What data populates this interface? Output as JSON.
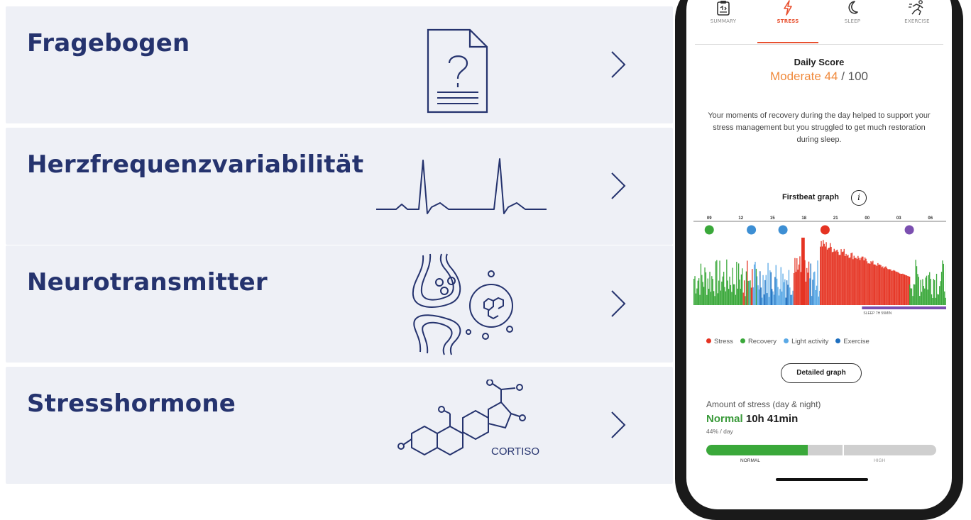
{
  "cards": [
    {
      "title": "Fragebogen",
      "icon": "questionnaire-document-icon"
    },
    {
      "title": "Herzfrequenzvariabilität",
      "icon": "heartbeat-ecg-icon"
    },
    {
      "title": "Neurotransmitter",
      "icon": "synapse-neurotransmitter-icon"
    },
    {
      "title": "Stresshormone",
      "icon": "cortisol-molecule-icon",
      "icon_label": "CORTISOL"
    }
  ],
  "colors": {
    "card_bg": "#eef0f6",
    "title": "#25336e",
    "stress": "#e53322",
    "recovery": "#3aa83a",
    "light_activity": "#5aa9e6",
    "exercise": "#1e6fbf",
    "accent": "#e8502f",
    "sleep": "#7b4fb0"
  },
  "app": {
    "tabs": [
      {
        "label": "SUMMARY",
        "icon": "summary-clipboard-icon",
        "active": false
      },
      {
        "label": "STRESS",
        "icon": "lightning-icon",
        "active": true
      },
      {
        "label": "SLEEP",
        "icon": "moon-icon",
        "active": false
      },
      {
        "label": "EXERCISE",
        "icon": "running-person-icon",
        "active": false
      }
    ],
    "daily_score": {
      "title": "Daily Score",
      "level": "Moderate",
      "value": "44",
      "max": "/ 100"
    },
    "description": "Your moments of recovery during the day helped to support your stress management but you struggled to get much restoration during sleep.",
    "graph": {
      "title": "Firstbeat graph",
      "info_icon": "info-icon",
      "sleep_label": "SLEEP 7H 59MIN"
    },
    "legend": [
      {
        "label": "Stress",
        "color": "#e53322"
      },
      {
        "label": "Recovery",
        "color": "#3aa83a"
      },
      {
        "label": "Light activity",
        "color": "#5aa9e6"
      },
      {
        "label": "Exercise",
        "color": "#1e6fbf"
      }
    ],
    "detailed_button": "Detailed graph",
    "amount": {
      "label": "Amount of stress (day & night)",
      "level": "Normal",
      "duration": "10h 41min",
      "percent_text": "44% / day",
      "fill_percent": 44
    },
    "bar_labels": {
      "normal": "NORMAL",
      "high": "HIGH"
    }
  },
  "chart_data": {
    "type": "bar",
    "title": "Firstbeat graph",
    "x_ticks": [
      "09",
      "12",
      "15",
      "18",
      "21",
      "00",
      "03",
      "06"
    ],
    "events": [
      {
        "time": "09",
        "type": "recovery"
      },
      {
        "time": "13",
        "type": "exercise"
      },
      {
        "time": "16",
        "type": "exercise"
      },
      {
        "time": "20",
        "type": "stress"
      },
      {
        "time": "04",
        "type": "sleep"
      }
    ],
    "segments": [
      {
        "from": "07:30",
        "to": "12:00",
        "category": "recovery"
      },
      {
        "from": "12:00",
        "to": "13:30",
        "category": "mixed"
      },
      {
        "from": "13:30",
        "to": "17:00",
        "category": "light activity"
      },
      {
        "from": "17:00",
        "to": "18:30",
        "category": "stress"
      },
      {
        "from": "18:30",
        "to": "19:30",
        "category": "light activity"
      },
      {
        "from": "19:30",
        "to": "04:00",
        "category": "stress"
      },
      {
        "from": "04:00",
        "to": "07:30",
        "category": "recovery"
      }
    ],
    "sleep": {
      "from": "23:30",
      "to": "07:30",
      "label": "SLEEP 7H 59MIN"
    }
  }
}
